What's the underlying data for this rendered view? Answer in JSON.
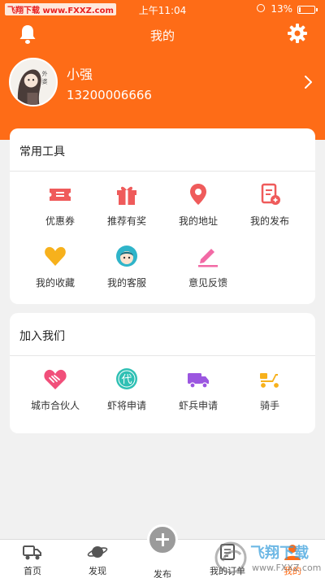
{
  "status_bar": {
    "site_watermark": "飞翔下载 www.FXXZ.com",
    "time": "上午11:04",
    "battery_text": "13%",
    "battery_level": 0.13
  },
  "header": {
    "title": "我的",
    "bell_icon": "bell-icon",
    "settings_icon": "gear-icon"
  },
  "profile": {
    "name": "小强",
    "phone": "13200006666",
    "avatar_caption": "外 婆"
  },
  "tools_card": {
    "title": "常用工具",
    "items": [
      {
        "label": "优惠券",
        "icon": "coupon-icon",
        "color": "#ef5b5b"
      },
      {
        "label": "推荐有奖",
        "icon": "gift-icon",
        "color": "#ef5b5b"
      },
      {
        "label": "我的地址",
        "icon": "location-pin-icon",
        "color": "#ef5b5b"
      },
      {
        "label": "我的发布",
        "icon": "document-icon",
        "color": "#ef5b5b"
      },
      {
        "label": "我的收藏",
        "icon": "heart-icon",
        "color": "#f7b11c"
      },
      {
        "label": "我的客服",
        "icon": "customer-service-icon",
        "color": "#2fb4c9"
      },
      {
        "label": "意见反馈",
        "icon": "feedback-icon",
        "color": "#f26aa5"
      }
    ]
  },
  "join_card": {
    "title": "加入我们",
    "items": [
      {
        "label": "城市合伙人",
        "icon": "handshake-icon",
        "color": "#f14f7a"
      },
      {
        "label": "虾将申请",
        "icon": "agent-badge-icon",
        "color": "#2fc0b4"
      },
      {
        "label": "虾兵申请",
        "icon": "truck-icon",
        "color": "#9b56e0"
      },
      {
        "label": "骑手",
        "icon": "scooter-icon",
        "color": "#f7b11c"
      }
    ]
  },
  "tab_bar": {
    "tabs": [
      {
        "label": "首页",
        "icon": "home-truck-icon"
      },
      {
        "label": "发现",
        "icon": "planet-icon"
      },
      {
        "label": "发布",
        "icon": "plus-icon"
      },
      {
        "label": "我的订单",
        "icon": "orders-icon"
      },
      {
        "label": "我的",
        "icon": "profile-icon"
      }
    ],
    "active_index": 4
  },
  "watermark": {
    "text": "飞翔下载",
    "url": "www.FXXZ.com"
  },
  "colors": {
    "brand_orange": "#fe6c17",
    "page_bg": "#f1f1f1"
  }
}
